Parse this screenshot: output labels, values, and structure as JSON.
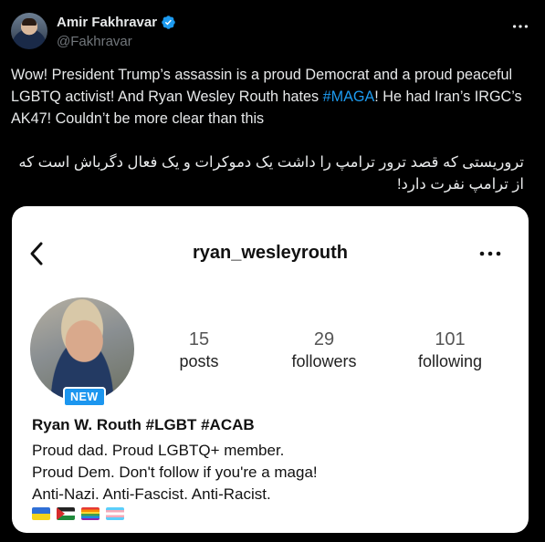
{
  "author": {
    "display_name": "Amir Fakhravar",
    "handle": "@Fakhravar"
  },
  "tweet": {
    "text_before_hashtag": "Wow! President Trump’s assassin is a proud Democrat and a proud peaceful LGBTQ activist! And Ryan Wesley Routh hates ",
    "hashtag": "#MAGA",
    "text_after_hashtag": "! He had Iran’s IRGC’s AK47! Couldn’t be more clear than this",
    "persian_text": "تروریستی که قصد ترور ترامپ را داشت یک دموکرات و یک فعال دگرباش است که از ترامپ نفرت دارد!"
  },
  "instagram": {
    "username": "ryan_wesleyrouth",
    "new_badge": "NEW",
    "stats": [
      {
        "number": "15",
        "label": "posts"
      },
      {
        "number": "29",
        "label": "followers"
      },
      {
        "number": "101",
        "label": "following"
      }
    ],
    "full_name": "Ryan W. Routh #LGBT #ACAB",
    "bio_lines": [
      "Proud dad. Proud LGBTQ+ member.",
      "Proud Dem. Don't follow if you're a maga!",
      "Anti-Nazi. Anti-Fascist. Anti-Racist."
    ],
    "flags": [
      "ukraine-flag-icon",
      "palestine-flag-icon",
      "rainbow-flag-icon",
      "transgender-flag-icon"
    ]
  },
  "colors": {
    "background": "#000000",
    "text": "#e7e9ea",
    "secondary_text": "#71767b",
    "accent": "#1d9bf0",
    "verified": "#1d9bf0",
    "card_background": "#ffffff",
    "new_badge": "#1c96ef"
  }
}
